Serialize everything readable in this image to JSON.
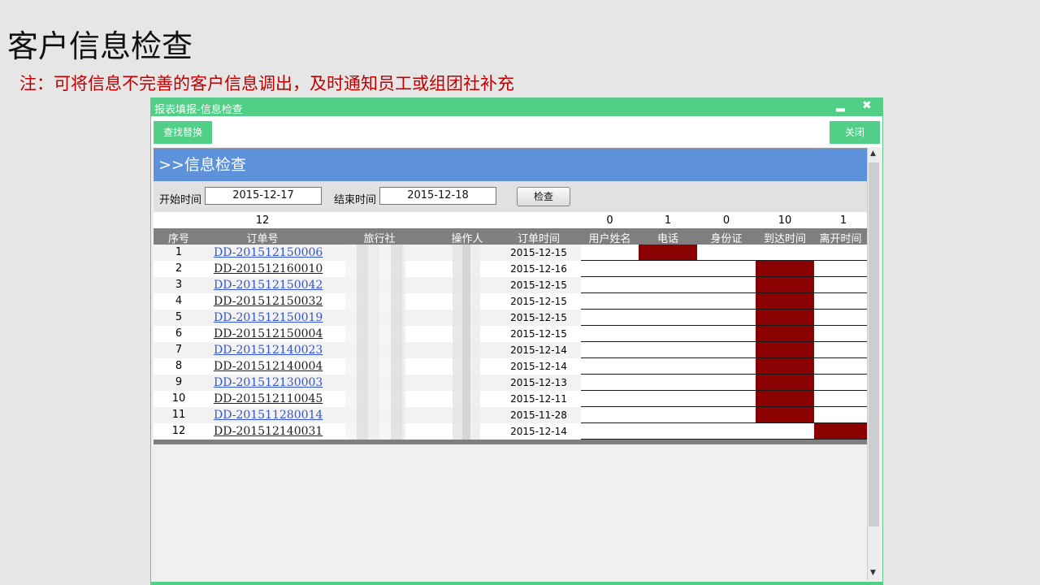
{
  "slide": {
    "title": "客户信息检查",
    "note": "注：可将信息不完善的客户信息调出，及时通知员工或组团社补充"
  },
  "window": {
    "title": "报表填报-信息检查",
    "minimize_glyph": "▂",
    "close_glyph": "✖",
    "toolbar": {
      "find_replace_label": "查找替换",
      "close_label": "关闭"
    }
  },
  "panel": {
    "header": ">>信息检查",
    "filter": {
      "start_label": "开始时间",
      "start_value": "2015-12-17",
      "end_label": "结束时间",
      "end_value": "2015-12-18",
      "check_label": "检查"
    }
  },
  "table": {
    "counts": {
      "order_no": "12",
      "user_name": "0",
      "phone": "1",
      "id_card": "0",
      "arrival_time": "10",
      "departure_time": "1"
    },
    "headers": {
      "seq": "序号",
      "order_no": "订单号",
      "agency": "旅行社",
      "operator": "操作人",
      "order_time": "订单时间",
      "user_name": "用户姓名",
      "phone": "电话",
      "id_card": "身份证",
      "arrival_time": "到达时间",
      "departure_time": "离开时间"
    },
    "rows": [
      {
        "seq": "1",
        "order_no": "DD-201512150006",
        "link": true,
        "order_time": "2015-12-15",
        "missing": [
          false,
          true,
          false,
          false,
          false
        ]
      },
      {
        "seq": "2",
        "order_no": "DD-201512160010",
        "link": false,
        "order_time": "2015-12-16",
        "missing": [
          false,
          false,
          false,
          true,
          false
        ]
      },
      {
        "seq": "3",
        "order_no": "DD-201512150042",
        "link": true,
        "order_time": "2015-12-15",
        "missing": [
          false,
          false,
          false,
          true,
          false
        ]
      },
      {
        "seq": "4",
        "order_no": "DD-201512150032",
        "link": false,
        "order_time": "2015-12-15",
        "missing": [
          false,
          false,
          false,
          true,
          false
        ]
      },
      {
        "seq": "5",
        "order_no": "DD-201512150019",
        "link": true,
        "order_time": "2015-12-15",
        "missing": [
          false,
          false,
          false,
          true,
          false
        ]
      },
      {
        "seq": "6",
        "order_no": "DD-201512150004",
        "link": false,
        "order_time": "2015-12-15",
        "missing": [
          false,
          false,
          false,
          true,
          false
        ]
      },
      {
        "seq": "7",
        "order_no": "DD-201512140023",
        "link": true,
        "order_time": "2015-12-14",
        "missing": [
          false,
          false,
          false,
          true,
          false
        ]
      },
      {
        "seq": "8",
        "order_no": "DD-201512140004",
        "link": false,
        "order_time": "2015-12-14",
        "missing": [
          false,
          false,
          false,
          true,
          false
        ]
      },
      {
        "seq": "9",
        "order_no": "DD-201512130003",
        "link": true,
        "order_time": "2015-12-13",
        "missing": [
          false,
          false,
          false,
          true,
          false
        ]
      },
      {
        "seq": "10",
        "order_no": "DD-201512110045",
        "link": false,
        "order_time": "2015-12-11",
        "missing": [
          false,
          false,
          false,
          true,
          false
        ]
      },
      {
        "seq": "11",
        "order_no": "DD-201511280014",
        "link": true,
        "order_time": "2015-11-28",
        "missing": [
          false,
          false,
          false,
          true,
          false
        ]
      },
      {
        "seq": "12",
        "order_no": "DD-201512140031",
        "link": false,
        "order_time": "2015-12-14",
        "missing": [
          false,
          false,
          false,
          false,
          true
        ]
      }
    ]
  },
  "scrollbar": {
    "up_glyph": "▲",
    "down_glyph": "▼"
  },
  "colors": {
    "titlebar": "#52cf86",
    "header_blue": "#5d92da",
    "missing_flag": "#8b0000",
    "note_red": "#c00000",
    "link_blue": "#3355cc"
  }
}
